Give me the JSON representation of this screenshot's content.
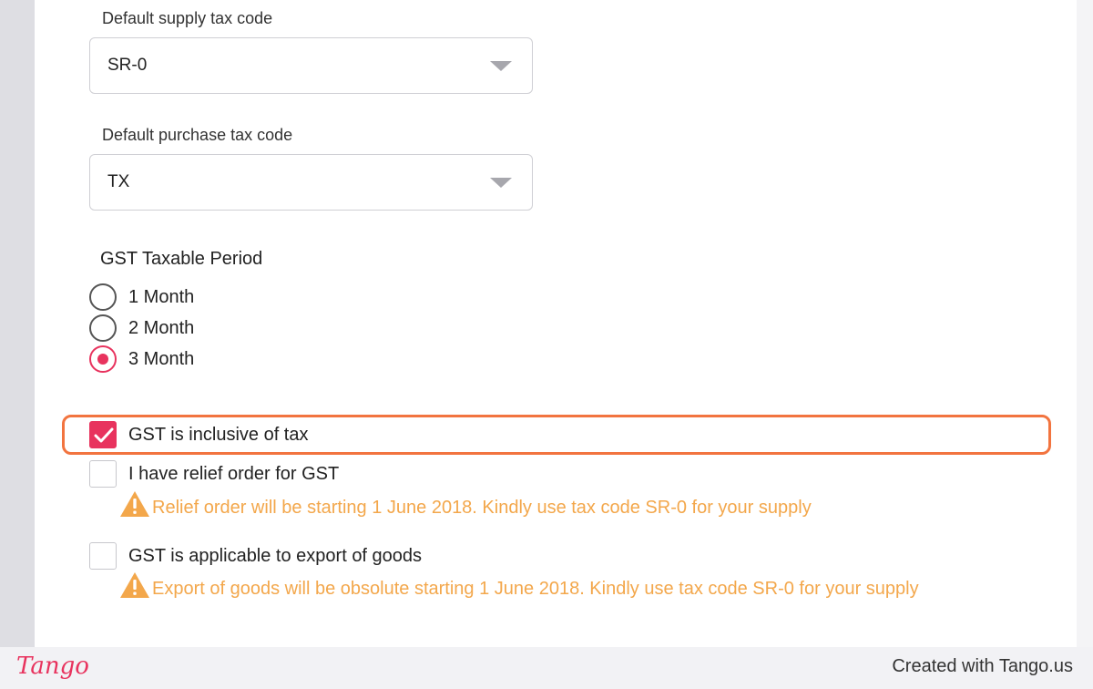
{
  "form": {
    "supply_tax": {
      "label": "Default supply tax code",
      "value": "SR-0"
    },
    "purchase_tax": {
      "label": "Default purchase tax code",
      "value": "TX"
    },
    "period": {
      "label": "GST Taxable Period",
      "options": [
        {
          "label": "1 Month",
          "selected": false
        },
        {
          "label": "2 Month",
          "selected": false
        },
        {
          "label": "3 Month",
          "selected": true
        }
      ]
    },
    "checkboxes": {
      "inclusive": {
        "label": "GST is inclusive of tax",
        "checked": true
      },
      "relief": {
        "label": "I have relief order for GST",
        "checked": false,
        "warning": "Relief order will be starting 1 June 2018. Kindly use tax code SR-0 for your supply"
      },
      "export": {
        "label": "GST is applicable to export of goods",
        "checked": false,
        "warning": "Export of goods will be obsolute starting 1 June 2018. Kindly use tax code SR-0 for your supply"
      }
    }
  },
  "colors": {
    "accent": "#e8335e",
    "warning": "#f3a74b",
    "highlight": "#f2743f"
  },
  "footer": {
    "logo": "Tango",
    "credit": "Created with Tango.us"
  }
}
